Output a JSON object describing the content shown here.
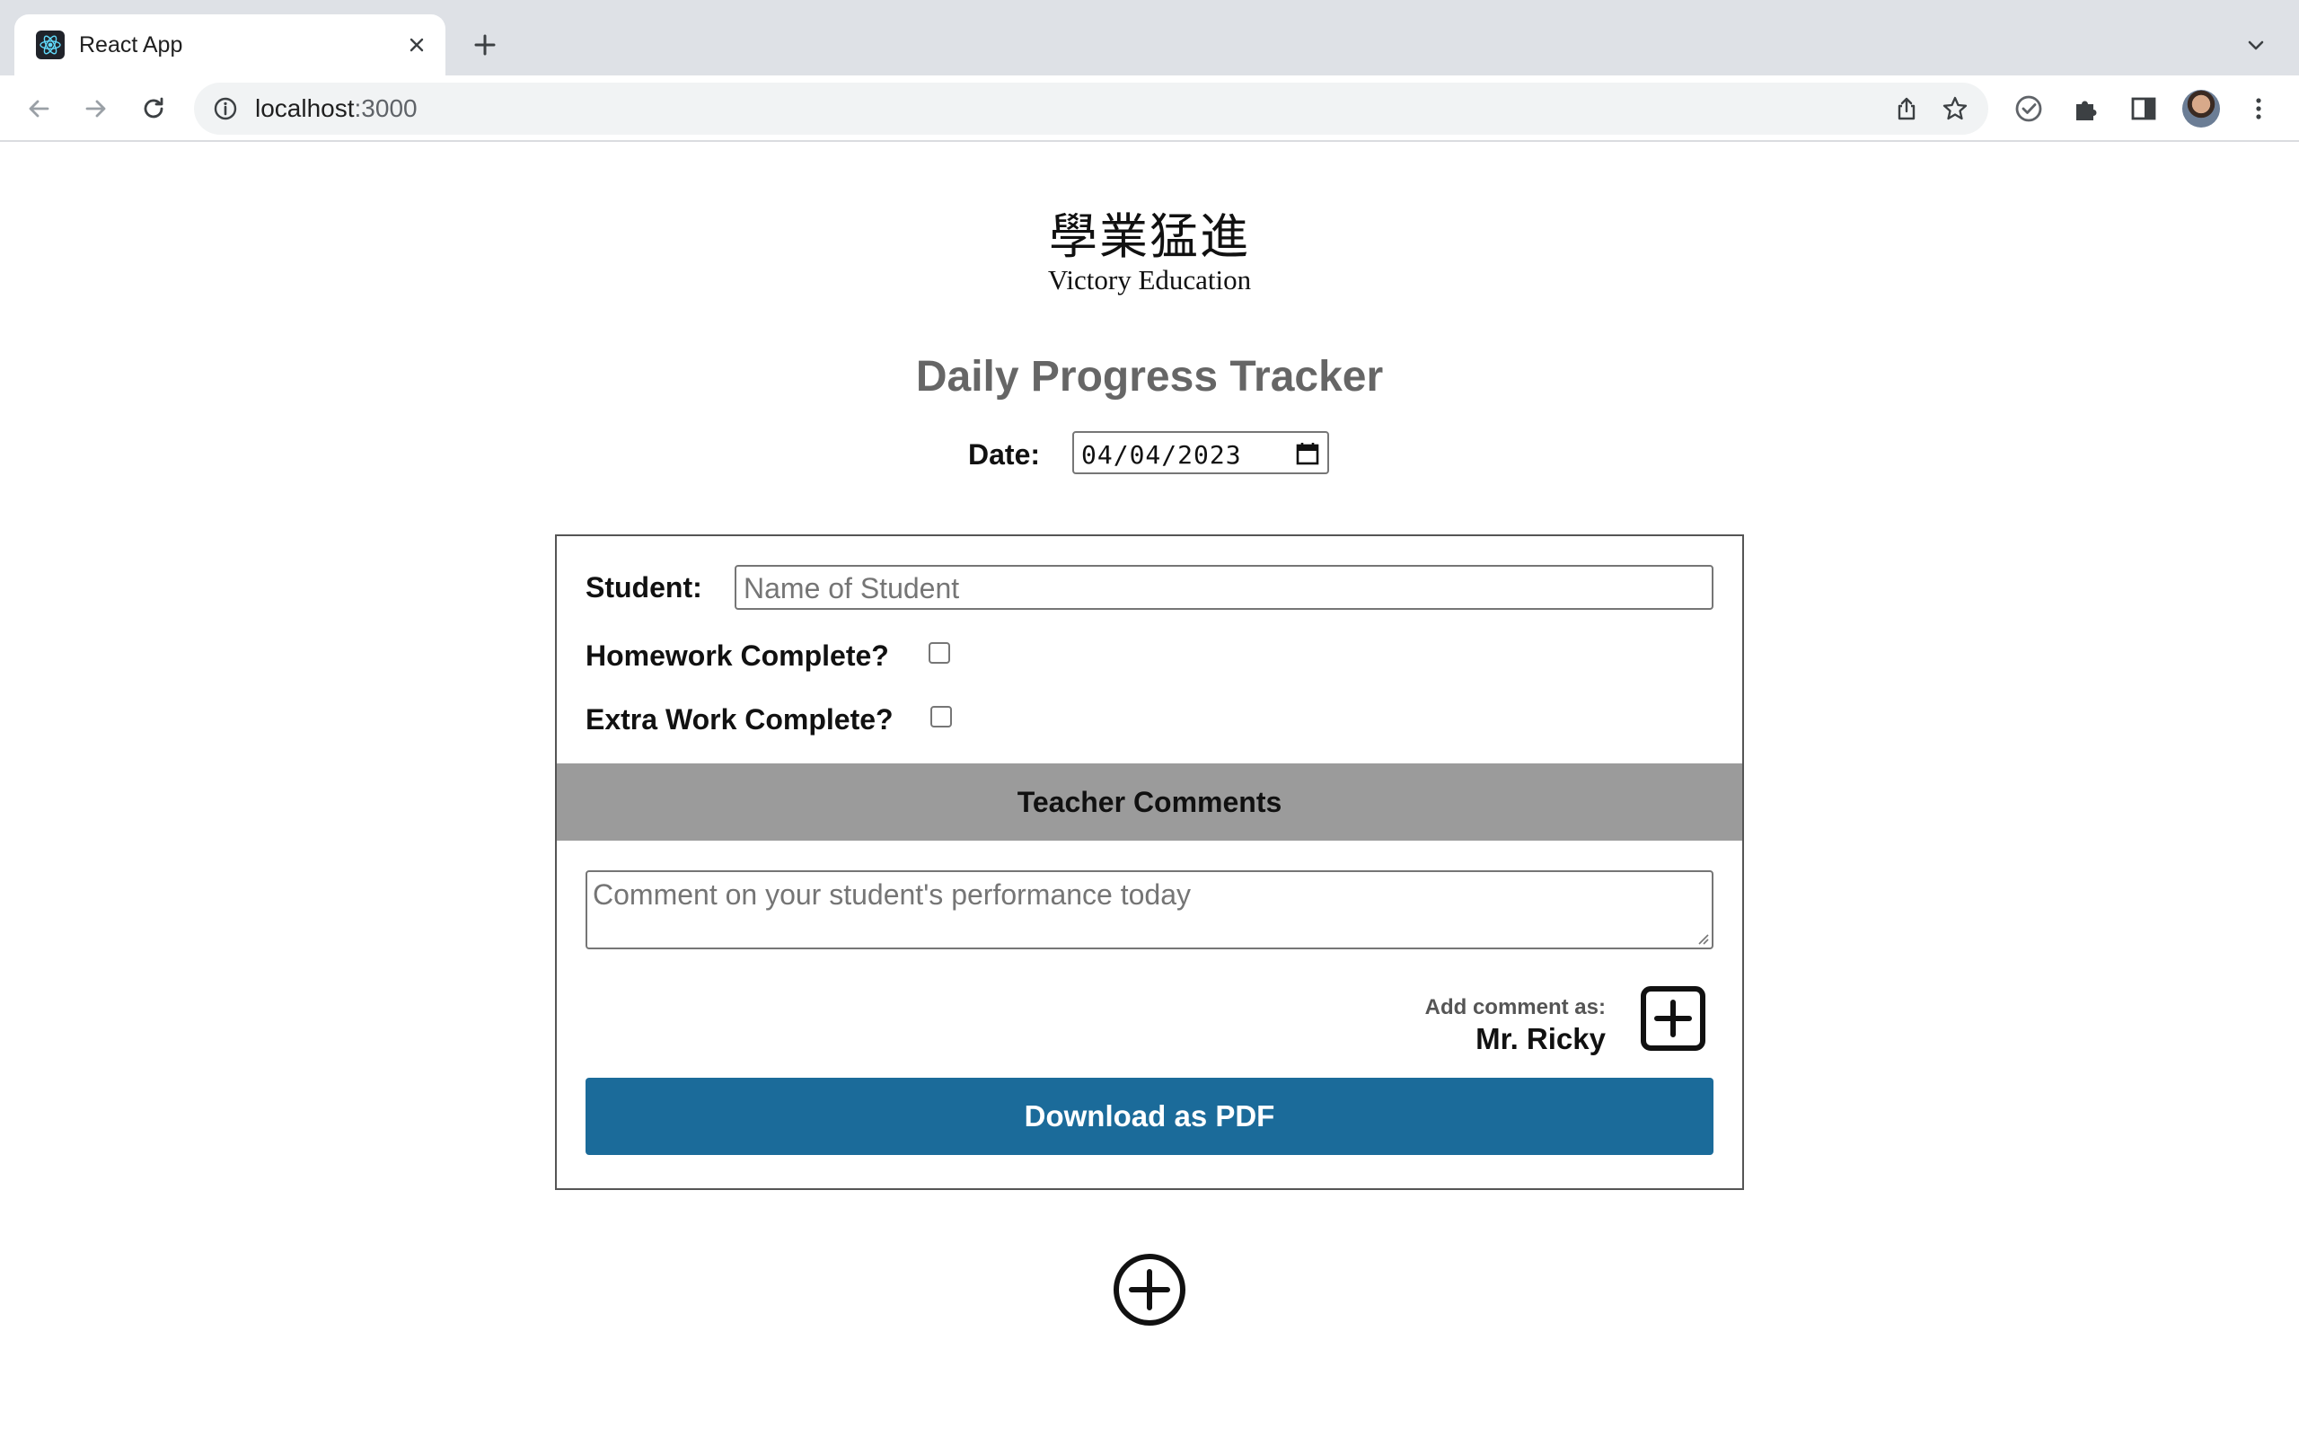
{
  "browser": {
    "tab_title": "React App",
    "url_host": "localhost",
    "url_port": ":3000"
  },
  "logo": {
    "chinese": "學業猛進",
    "english": "Victory Education"
  },
  "page": {
    "title": "Daily Progress Tracker",
    "date_label": "Date:",
    "date_value": "04/04/2023"
  },
  "form": {
    "student_label": "Student:",
    "student_placeholder": "Name of Student",
    "student_value": "",
    "homework_label": "Homework Complete?",
    "homework_checked": false,
    "extra_label": "Extra Work Complete?",
    "extra_checked": false,
    "comments_header": "Teacher Comments",
    "comment_placeholder": "Comment on your student's performance today",
    "comment_value": "",
    "add_as_label": "Add comment as:",
    "teacher_name": "Mr. Ricky",
    "download_label": "Download as PDF"
  },
  "colors": {
    "primary_button": "#1b6b9a",
    "comments_header_bg": "#9b9b9b",
    "title_text": "#666666"
  },
  "icons": [
    "react-logo-icon",
    "close-icon",
    "plus-icon",
    "chevron-down-icon",
    "back-arrow-icon",
    "forward-arrow-icon",
    "reload-icon",
    "info-icon",
    "share-icon",
    "star-icon",
    "check-circle-icon",
    "puzzle-icon",
    "side-panel-icon",
    "kebab-menu-icon",
    "calendar-icon",
    "add-square-icon",
    "add-circle-icon"
  ]
}
